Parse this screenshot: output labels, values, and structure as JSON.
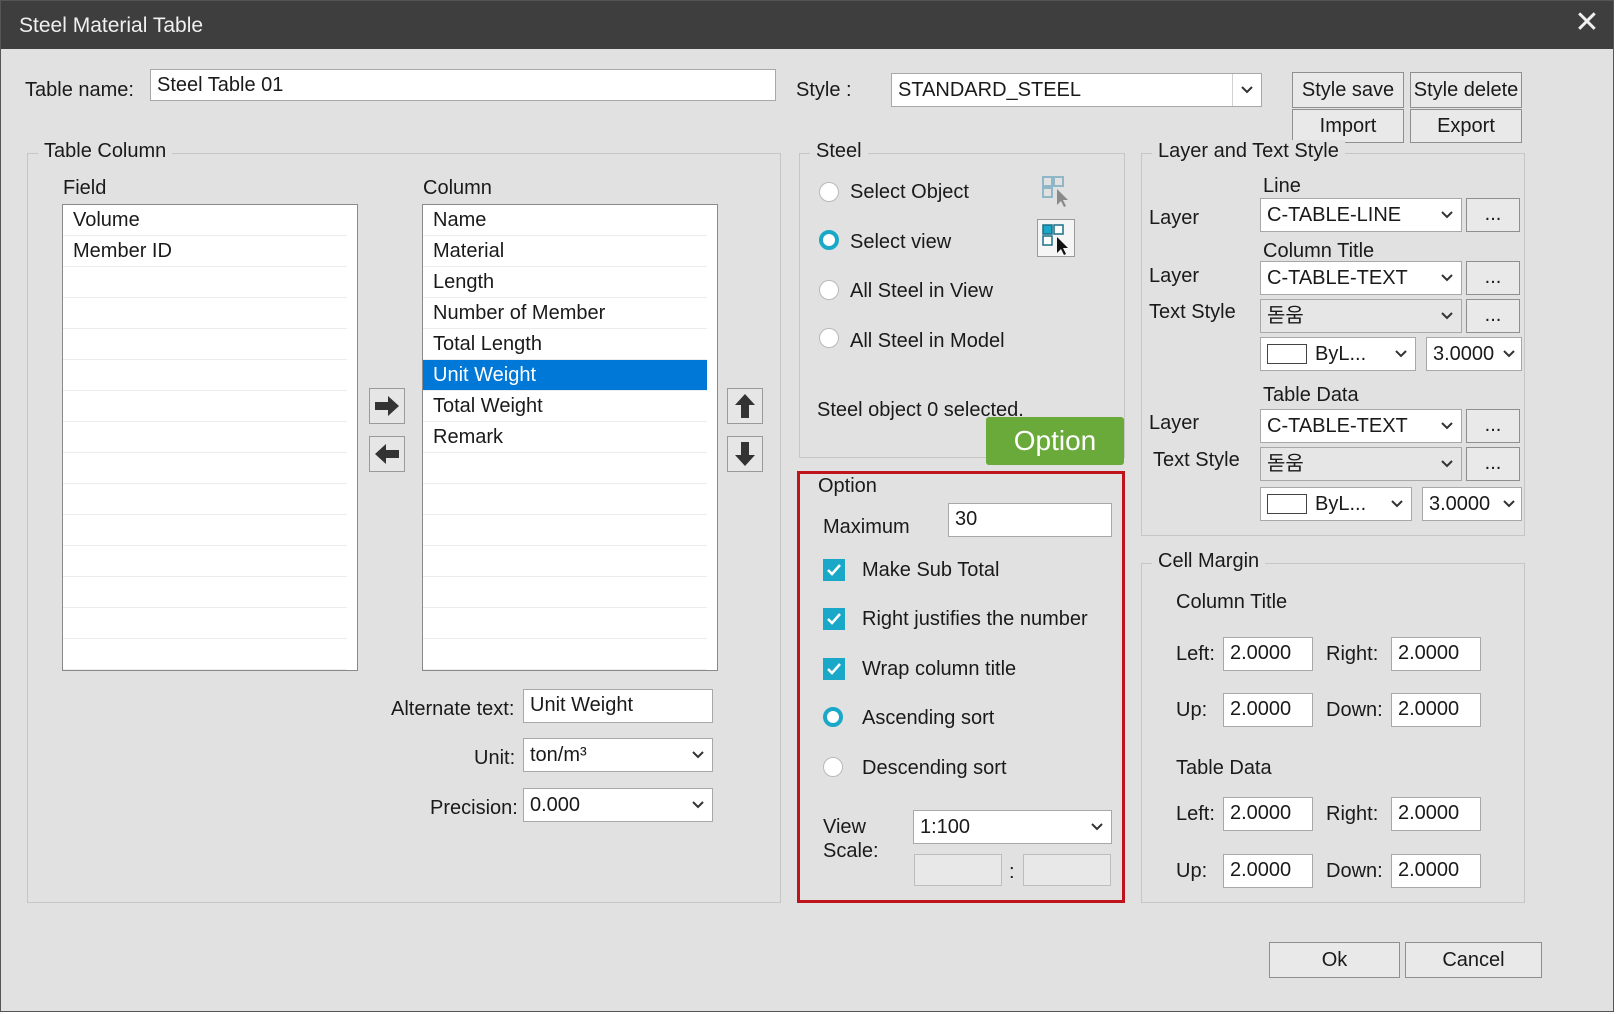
{
  "window": {
    "title": "Steel Material Table",
    "close_glyph": "✕"
  },
  "header": {
    "table_name_label": "Table name:",
    "table_name_value": "Steel Table 01",
    "style_label": "Style :",
    "style_value": "STANDARD_STEEL",
    "buttons": {
      "style_save": "Style save",
      "style_delete": "Style delete",
      "import": "Import",
      "export": "Export"
    }
  },
  "table_column": {
    "title": "Table Column",
    "field_label": "Field",
    "column_label": "Column",
    "fields": [
      "Volume",
      "Member ID"
    ],
    "columns": [
      "Name",
      "Material",
      "Length",
      "Number of Member",
      "Total Length",
      "Unit Weight",
      "Total Weight",
      "Remark"
    ],
    "selected_column": "Unit Weight",
    "alternate_text_label": "Alternate text:",
    "alternate_text_value": "Unit Weight",
    "unit_label": "Unit:",
    "unit_value": "ton/m³",
    "precision_label": "Precision:",
    "precision_value": "0.000"
  },
  "steel": {
    "title": "Steel",
    "options": [
      "Select Object",
      "Select view",
      "All Steel in View",
      "All Steel in Model"
    ],
    "selected": "Select view",
    "status": "Steel object 0 selected."
  },
  "option_tag": "Option",
  "option": {
    "title": "Option",
    "maximum_label": "Maximum",
    "maximum_value": "30",
    "checks": [
      "Make Sub Total",
      "Right justifies the number",
      "Wrap column title"
    ],
    "sort_options": [
      "Ascending sort",
      "Descending sort"
    ],
    "sort_selected": "Ascending sort",
    "view_label": "View",
    "scale_label": "Scale:",
    "view_scale_value": "1:100",
    "scale_separator": ":"
  },
  "layer_text_style": {
    "title": "Layer and Text Style",
    "line_heading": "Line",
    "line_layer_label": "Layer",
    "line_layer_value": "C-TABLE-LINE",
    "column_title_heading": "Column Title",
    "ct_layer_label": "Layer",
    "ct_layer_value": "C-TABLE-TEXT",
    "ct_text_style_label": "Text Style",
    "ct_text_style_value": "돋움",
    "ct_color_value": "ByL...",
    "ct_height_value": "3.0000",
    "table_data_heading": "Table Data",
    "td_layer_label": "Layer",
    "td_layer_value": "C-TABLE-TEXT",
    "td_text_style_label": "Text Style",
    "td_text_style_value": "돋움",
    "td_color_value": "ByL...",
    "td_height_value": "3.0000",
    "ellipsis": "..."
  },
  "cell_margin": {
    "title": "Cell Margin",
    "column_title_heading": "Column Title",
    "table_data_heading": "Table Data",
    "left_label": "Left:",
    "right_label": "Right:",
    "up_label": "Up:",
    "down_label": "Down:",
    "ct_left": "2.0000",
    "ct_right": "2.0000",
    "ct_up": "2.0000",
    "ct_down": "2.0000",
    "td_left": "2.0000",
    "td_right": "2.0000",
    "td_up": "2.0000",
    "td_down": "2.0000"
  },
  "footer": {
    "ok": "Ok",
    "cancel": "Cancel"
  },
  "colors": {
    "accent": "#1aa8c8",
    "selection": "#0078d7",
    "highlight_outline": "#c0141c",
    "tag": "#6aaa3a",
    "titlebar": "#3e3e3e"
  }
}
